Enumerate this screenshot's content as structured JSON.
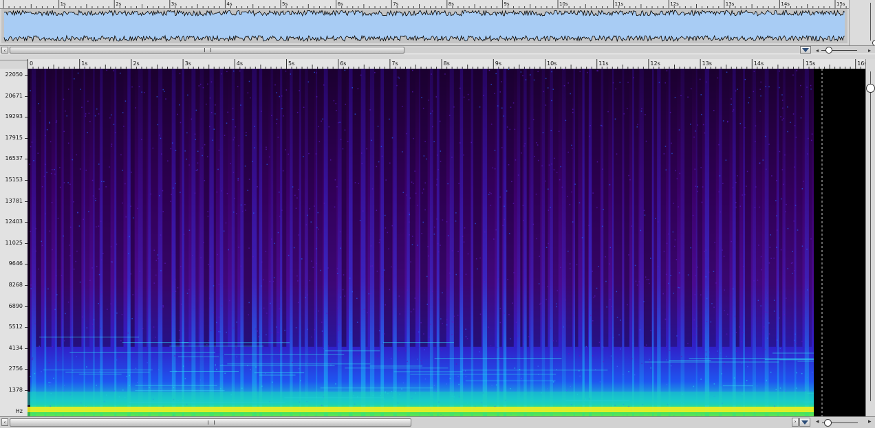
{
  "overview": {
    "ruler_labels": [
      "1s",
      "2s",
      "3s",
      "4s",
      "5s",
      "6s",
      "7s",
      "8s",
      "9s",
      "10s",
      "11s",
      "12s",
      "13s",
      "14s",
      "15s"
    ]
  },
  "main": {
    "time_labels": [
      "0",
      "1s",
      "2s",
      "3s",
      "4s",
      "5s",
      "6s",
      "7s",
      "8s",
      "9s",
      "10s",
      "11s",
      "12s",
      "13s",
      "14s",
      "15s",
      "16s"
    ],
    "freq_labels": [
      "22050",
      "20671",
      "19293",
      "17915",
      "16537",
      "15153",
      "13781",
      "12403",
      "11025",
      "9646",
      "8268",
      "6890",
      "5512",
      "4134",
      "2756",
      "1378",
      "Hz"
    ]
  },
  "colors": {
    "waveform_fill": "#a8ccf4",
    "waveform_line": "#000000",
    "spectrogram_low": "#3a0066",
    "spectrogram_mid": "#1a3cff",
    "spectrogram_high": "#19e6c8",
    "spectrogram_peak": "#f0f020",
    "playhead": "#cccccc"
  },
  "icons": {
    "scroll_down": "triangle-down-icon",
    "zoom_handle": "zoom-slider-icon"
  },
  "scroll": {
    "overview_h_fraction": 0.46,
    "main_h_fraction": 0.47
  }
}
